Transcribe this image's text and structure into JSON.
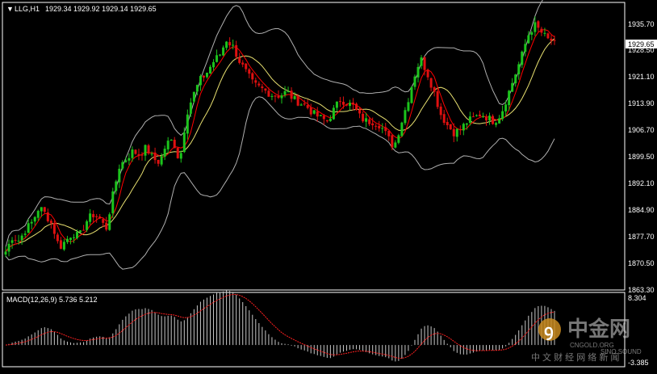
{
  "header": {
    "arrow": "▼",
    "symbol_tf": "LLG,H1",
    "ohlc": "1929.34 1929.92 1929.14 1929.65"
  },
  "price_axis": {
    "ticks": [
      "1935.70",
      "1921.10",
      "1913.90",
      "1906.70",
      "1899.50",
      "1892.10",
      "1884.90",
      "1877.70",
      "1870.50",
      "1863.30"
    ],
    "partial_tick": "1928.50",
    "current_price": "1929.65"
  },
  "macd": {
    "label": "MACD(12,26,9) 5.736 5.212",
    "axis_top": "8.304",
    "axis_bottom": "-3.385"
  },
  "watermark": {
    "brand": "中金网",
    "brand_en": "CNGOLD.ORG",
    "sub": "SINO SOUND",
    "sub2": "中 文 财 经 网 络 新 闻"
  },
  "colors": {
    "background": "#000000",
    "bull_candle": "#1cc41c",
    "bear_candle": "#e01010",
    "bollinger": "#b0b0b0",
    "ma_fast": "#ff0000",
    "ma_slow": "#e8e070",
    "macd_hist": "#c8c8c8",
    "macd_signal": "#ff2020",
    "axis": "#ffffff"
  },
  "chart_data": {
    "type": "candlestick",
    "symbol": "LLG",
    "timeframe": "H1",
    "ylim": [
      1863.3,
      1938.5
    ],
    "close_path": [
      1873,
      1877,
      1876,
      1879,
      1881,
      1885,
      1883,
      1880,
      1874,
      1876,
      1878,
      1877,
      1881,
      1883,
      1882,
      1879,
      1888,
      1896,
      1898,
      1900,
      1899,
      1901,
      1898,
      1897,
      1902,
      1903,
      1897,
      1910,
      1915,
      1919,
      1921,
      1924,
      1926,
      1930,
      1928,
      1924,
      1921,
      1918,
      1917,
      1916,
      1915,
      1915,
      1916,
      1914,
      1913,
      1912,
      1910,
      1909,
      1908,
      1911,
      1914,
      1913,
      1912,
      1909,
      1908,
      1908,
      1907,
      1904,
      1901,
      1907,
      1913,
      1920,
      1925,
      1921,
      1916,
      1910,
      1907,
      1905,
      1906,
      1908,
      1909,
      1910,
      1909,
      1908,
      1910,
      1915,
      1920,
      1925,
      1931,
      1934,
      1932,
      1930,
      1929.65
    ],
    "macd_last": 5.736,
    "signal_last": 5.212
  }
}
